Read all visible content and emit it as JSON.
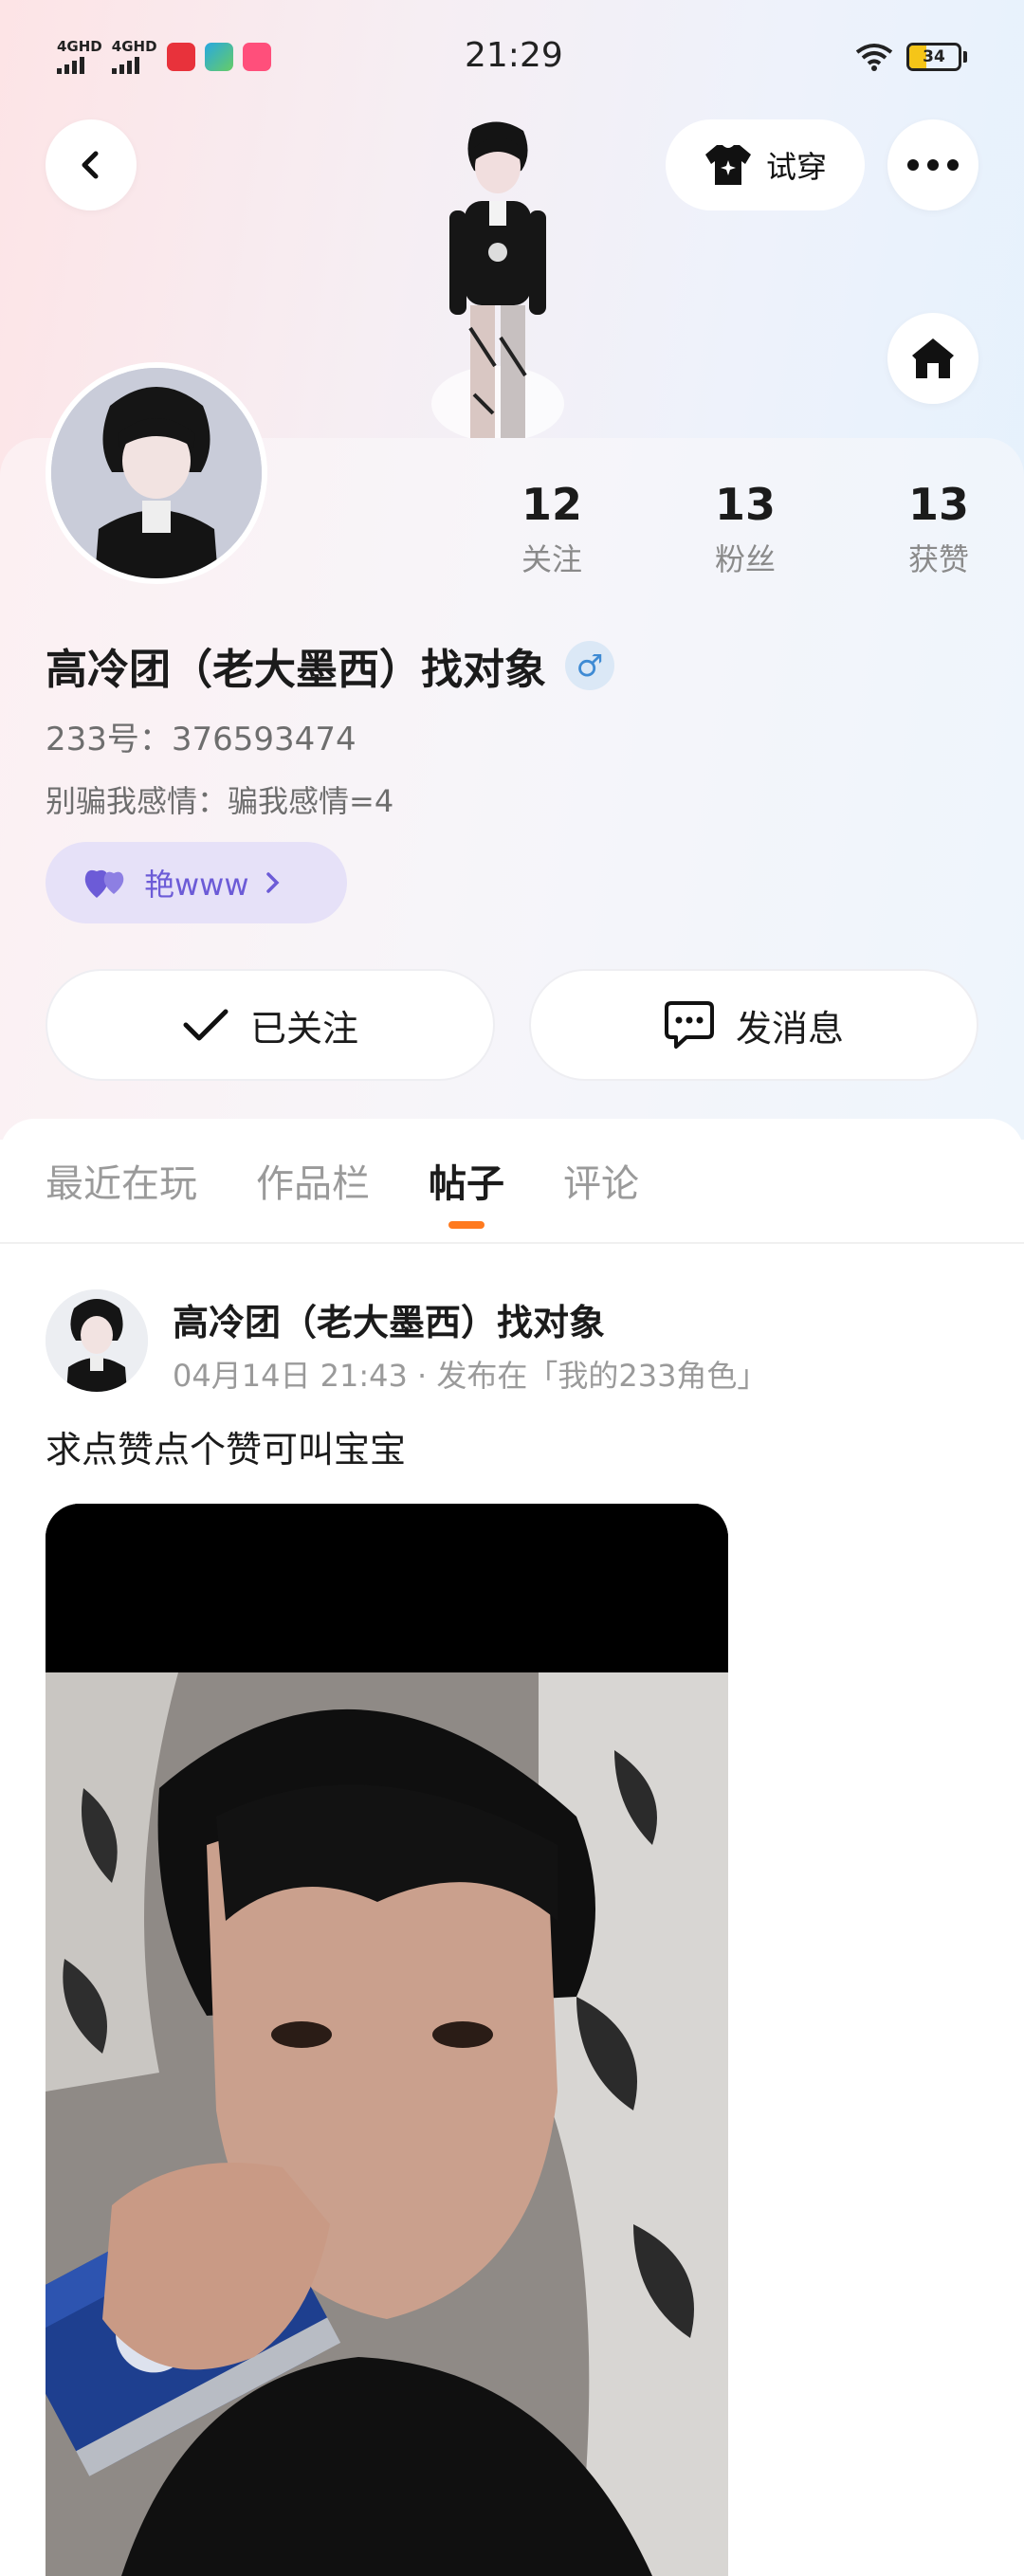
{
  "status_bar": {
    "signal_1": "4GHD",
    "signal_2": "4GHD",
    "time": "21:29",
    "battery": "34"
  },
  "header": {
    "back_icon": "chevron-left-icon",
    "try_on_label": "试穿",
    "more_icon": "more-horizontal-icon",
    "home_icon": "home-icon"
  },
  "profile": {
    "stats": [
      {
        "value": "12",
        "label": "关注"
      },
      {
        "value": "13",
        "label": "粉丝"
      },
      {
        "value": "13",
        "label": "获赞"
      }
    ],
    "name": "高冷团（老大墨西）找对象",
    "gender_symbol": "♂",
    "uid": "233号：376593474",
    "bio": "别骗我感情：骗我感情=4",
    "tag_label": "艳www",
    "follow_button": "已关注",
    "message_button": "发消息"
  },
  "tabs": [
    {
      "label": "最近在玩",
      "active": false
    },
    {
      "label": "作品栏",
      "active": false
    },
    {
      "label": "帖子",
      "active": true
    },
    {
      "label": "评论",
      "active": false
    }
  ],
  "post": {
    "author": "高冷团（老大墨西）找对象",
    "meta": "04月14日 21:43 · 发布在「我的233角色」",
    "text": "求点赞点个赞可叫宝宝"
  },
  "colors": {
    "accent_orange": "#ff7a1f",
    "tag_purple": "#6c5bd7",
    "gender_blue": "#3f8bd4"
  }
}
